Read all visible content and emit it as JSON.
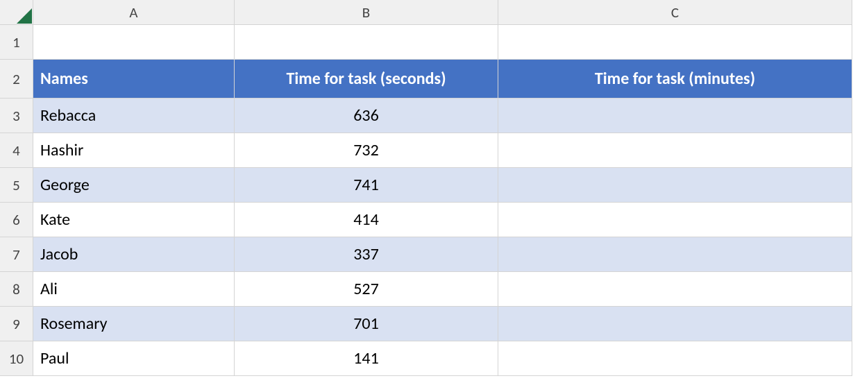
{
  "columns": [
    "A",
    "B",
    "C"
  ],
  "rowNumbers": [
    "1",
    "2",
    "3",
    "4",
    "5",
    "6",
    "7",
    "8",
    "9",
    "10"
  ],
  "headers": {
    "names": "Names",
    "seconds": "Time for task (seconds)",
    "minutes": "Time for task (minutes)"
  },
  "chart_data": {
    "type": "table",
    "columns": [
      "Names",
      "Time for task (seconds)",
      "Time for task (minutes)"
    ],
    "rows": [
      {
        "name": "Rebacca",
        "seconds": "636",
        "minutes": ""
      },
      {
        "name": "Hashir",
        "seconds": "732",
        "minutes": ""
      },
      {
        "name": "George",
        "seconds": "741",
        "minutes": ""
      },
      {
        "name": "Kate",
        "seconds": "414",
        "minutes": ""
      },
      {
        "name": "Jacob",
        "seconds": "337",
        "minutes": ""
      },
      {
        "name": "Ali",
        "seconds": "527",
        "minutes": ""
      },
      {
        "name": "Rosemary",
        "seconds": "701",
        "minutes": ""
      },
      {
        "name": "Paul",
        "seconds": "141",
        "minutes": ""
      }
    ]
  }
}
